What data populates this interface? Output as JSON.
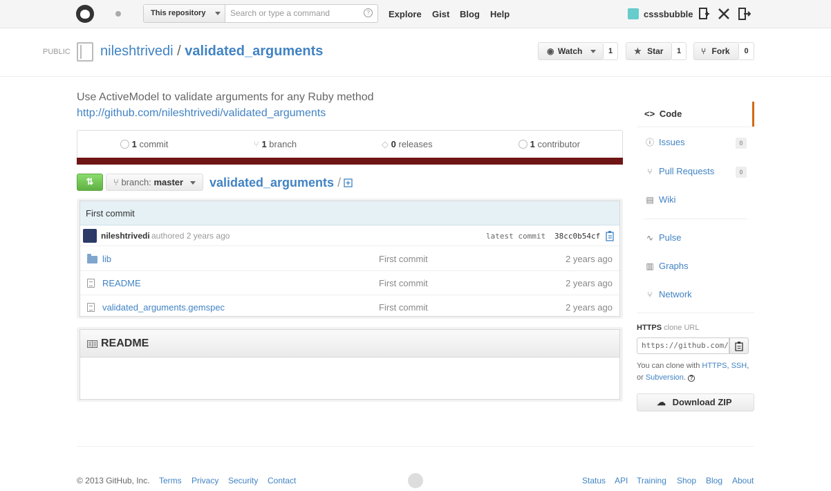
{
  "header": {
    "search_scope": "This repository",
    "search_placeholder": "Search or type a command",
    "nav": [
      "Explore",
      "Gist",
      "Blog",
      "Help"
    ],
    "username": "csssbubble"
  },
  "repo": {
    "visibility": "PUBLIC",
    "owner": "nileshtrivedi",
    "separator": "/",
    "name": "validated_arguments",
    "actions": {
      "watch_label": "Watch",
      "watch_count": "1",
      "star_label": "Star",
      "star_count": "1",
      "fork_label": "Fork",
      "fork_count": "0"
    },
    "description": "Use ActiveModel to validate arguments for any Ruby method",
    "homepage": "http://github.com/nileshtrivedi/validated_arguments"
  },
  "summary": {
    "commits_num": "1",
    "commits_label": "commit",
    "branches_num": "1",
    "branches_label": "branch",
    "releases_num": "0",
    "releases_label": "releases",
    "contributors_num": "1",
    "contributors_label": "contributor",
    "language_color": "#701516"
  },
  "filenav": {
    "branch_prefix": "branch:",
    "branch_name": "master",
    "path_root": "validated_arguments",
    "path_sep": "/"
  },
  "last_commit": {
    "message": "First commit",
    "author": "nileshtrivedi",
    "authored_text": "authored 2 years ago",
    "latest_label": "latest commit",
    "sha": "38cc0b54cf"
  },
  "files": [
    {
      "icon": "folder-icon",
      "name": "lib",
      "message": "First commit",
      "age": "2 years ago"
    },
    {
      "icon": "file-icon",
      "name": "README",
      "message": "First commit",
      "age": "2 years ago"
    },
    {
      "icon": "file-icon",
      "name": "validated_arguments.gemspec",
      "message": "First commit",
      "age": "2 years ago"
    }
  ],
  "readme": {
    "title": "README"
  },
  "sidebar": {
    "nav": [
      {
        "icon": "code-icon",
        "label": "Code"
      },
      {
        "icon": "issues-icon",
        "label": "Issues",
        "count": "0"
      },
      {
        "icon": "pull-request-icon",
        "label": "Pull Requests",
        "count": "0"
      },
      {
        "icon": "wiki-icon",
        "label": "Wiki"
      },
      {
        "icon": "pulse-icon",
        "label": "Pulse"
      },
      {
        "icon": "graphs-icon",
        "label": "Graphs"
      },
      {
        "icon": "network-icon",
        "label": "Network"
      }
    ],
    "clone": {
      "protocol": "HTTPS",
      "label": "clone URL",
      "url": "https://github.com/nileshtrivedi/validated_arguments.git",
      "help_prefix": "You can clone with",
      "opt_https": "HTTPS",
      "opt_ssh": "SSH",
      "or": "or",
      "opt_svn": "Subversion",
      "download_label": "Download ZIP"
    }
  },
  "footer": {
    "copyright": "© 2013 GitHub, Inc.",
    "left_links": [
      "Terms",
      "Privacy",
      "Security",
      "Contact"
    ],
    "right_links": [
      "Status",
      "API",
      "Training",
      "Shop",
      "Blog",
      "About"
    ]
  }
}
